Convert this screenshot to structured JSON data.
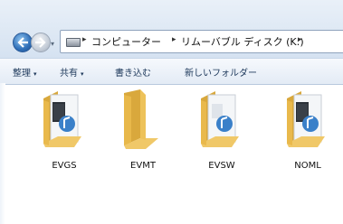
{
  "address": {
    "history_glyph": "▾",
    "separator": "▸",
    "crumbs": [
      "コンピューター",
      "リムーバブル ディスク (K:)"
    ]
  },
  "toolbar": {
    "organize": "整理",
    "share": "共有",
    "burn": "書き込む",
    "new_folder": "新しいフォルダー",
    "dropdown_glyph": "▾"
  },
  "items": [
    {
      "label": "EVGS",
      "icon": "media-folder-icon"
    },
    {
      "label": "EVMT",
      "icon": "empty-folder-icon"
    },
    {
      "label": "EVSW",
      "icon": "audio-folder-icon"
    },
    {
      "label": "NOML",
      "icon": "media-folder-icon"
    }
  ],
  "colors": {
    "folder": "#e8b84a",
    "accent": "#2f6fb8",
    "toolbar_text": "#1e395b"
  }
}
